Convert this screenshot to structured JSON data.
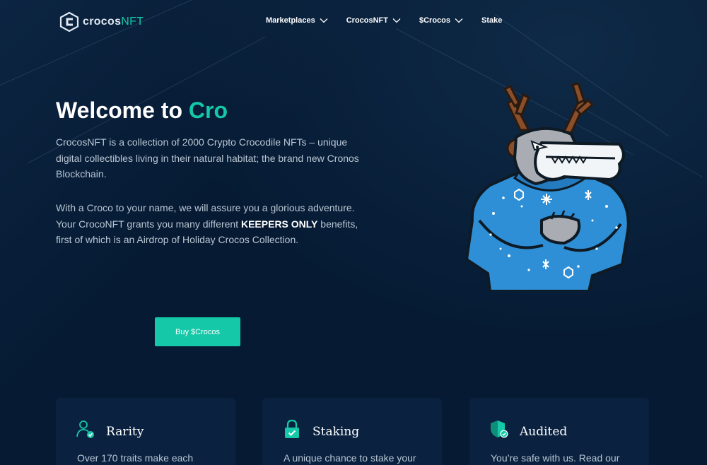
{
  "header": {
    "logo": {
      "brand_main": "crocos",
      "brand_suffix": "NFT"
    },
    "nav": [
      {
        "label": "Marketplaces",
        "has_dropdown": true
      },
      {
        "label": "CrocosNFT",
        "has_dropdown": true
      },
      {
        "label": "$Crocos",
        "has_dropdown": true
      },
      {
        "label": "Stake",
        "has_dropdown": false
      }
    ]
  },
  "hero": {
    "title_prefix": "Welcome to ",
    "title_accent": "Cro",
    "paragraph1": "CrocosNFT is a collection of 2000 Crypto Crocodile NFTs – unique digital collectibles living in their natural habitat; the brand new Cronos Blockchain.",
    "paragraph2_before": "With a Croco to your name, we will assure you a glorious adventure. Your CrocoNFT grants you many different ",
    "paragraph2_bold": "KEEPERS ONLY",
    "paragraph2_after": " benefits, first of which is an Airdrop of Holiday Crocos Collection.",
    "buy_button": "Buy $Crocos"
  },
  "features": [
    {
      "title": "Rarity",
      "text": "Over 170 traits make each",
      "icon": "user-check-icon"
    },
    {
      "title": "Staking",
      "text": "A unique chance to stake your",
      "icon": "lock-check-icon"
    },
    {
      "title": "Audited",
      "text": "You’re safe with us. Read our",
      "icon": "shield-check-icon"
    }
  ],
  "colors": {
    "background": "#061a33",
    "accent": "#14c8a8",
    "card": "#0a2240",
    "body_text": "#b9c6d3"
  }
}
